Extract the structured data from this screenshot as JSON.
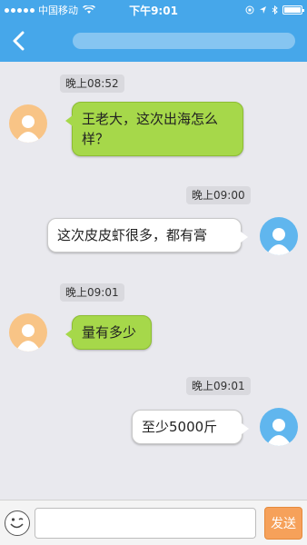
{
  "status_bar": {
    "carrier": "中国移动",
    "time": "下午9:01",
    "battery_level": 1.0
  },
  "nav": {
    "back_icon": "chevron-left-icon",
    "title": ""
  },
  "messages": [
    {
      "time": "晚上08:52",
      "side": "left",
      "avatar": "user-avatar-icon",
      "text": "王老大，这次出海怎么样？"
    },
    {
      "time": "晚上09:00",
      "side": "right",
      "avatar": "user-avatar-icon",
      "text": "这次皮皮虾很多，都有膏"
    },
    {
      "time": "晚上09:01",
      "side": "left",
      "avatar": "user-avatar-icon",
      "text": "量有多少"
    },
    {
      "time": "晚上09:01",
      "side": "right",
      "avatar": "user-avatar-icon",
      "text": "至少5000斤"
    }
  ],
  "input_bar": {
    "emoji_icon": "emoji-icon",
    "input_value": "",
    "send_label": "发送"
  },
  "colors": {
    "header": "#46a7ea",
    "left_bubble": "#a6d84a",
    "right_bubble": "#ffffff",
    "left_avatar": "#f8c486",
    "right_avatar": "#60b6ee",
    "send_button": "#f6a15a"
  }
}
